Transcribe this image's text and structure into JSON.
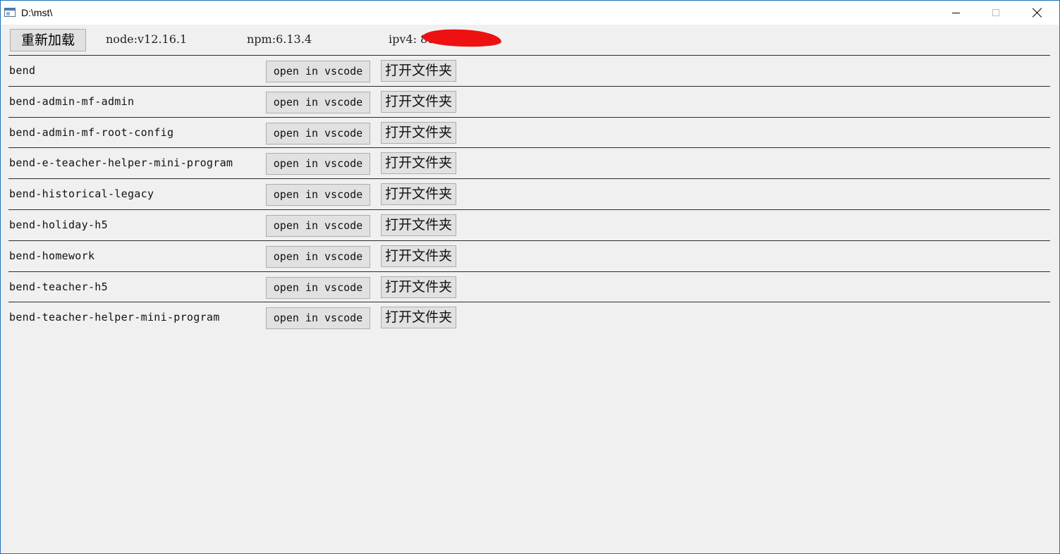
{
  "window": {
    "title": "D:\\mst\\"
  },
  "toolbar": {
    "reload_label": "重新加载",
    "node_version": "node:v12.16.1",
    "npm_version": "npm:6.13.4",
    "ipv4": "ipv4:          81"
  },
  "projects": [
    {
      "name": "bend",
      "vscode_label": "open in vscode",
      "folder_label": "打开文件夹"
    },
    {
      "name": "bend-admin-mf-admin",
      "vscode_label": "open in vscode",
      "folder_label": "打开文件夹"
    },
    {
      "name": "bend-admin-mf-root-config",
      "vscode_label": "open in vscode",
      "folder_label": "打开文件夹"
    },
    {
      "name": "bend-e-teacher-helper-mini-program",
      "vscode_label": "open in vscode",
      "folder_label": "打开文件夹"
    },
    {
      "name": "bend-historical-legacy",
      "vscode_label": "open in vscode",
      "folder_label": "打开文件夹"
    },
    {
      "name": "bend-holiday-h5",
      "vscode_label": "open in vscode",
      "folder_label": "打开文件夹"
    },
    {
      "name": "bend-homework",
      "vscode_label": "open in vscode",
      "folder_label": "打开文件夹"
    },
    {
      "name": "bend-teacher-h5",
      "vscode_label": "open in vscode",
      "folder_label": "打开文件夹"
    },
    {
      "name": "bend-teacher-helper-mini-program",
      "vscode_label": "open in vscode",
      "folder_label": "打开文件夹"
    }
  ],
  "colors": {
    "window_border": "#1f6fbf",
    "redaction": "#ee1111",
    "background": "#f0f0f0"
  },
  "icons": {
    "app": "window-app-icon",
    "minimize": "minimize-icon",
    "maximize": "maximize-icon",
    "close": "close-icon"
  }
}
